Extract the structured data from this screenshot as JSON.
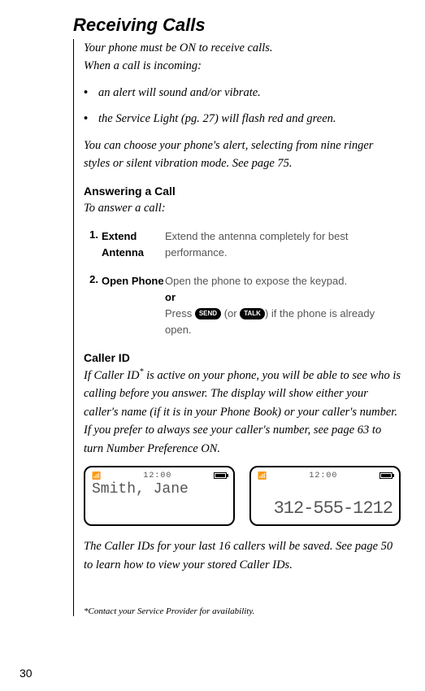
{
  "heading": "Receiving Calls",
  "intro1": "Your phone must be ON to receive calls.",
  "intro2": "When a call is incoming:",
  "bullets": [
    "an alert will sound and/or vibrate.",
    "the Service Light (pg. 27) will flash red and green."
  ],
  "intro3": "You can choose your phone's alert, selecting from nine ringer styles or silent vibration mode. See page 75.",
  "answering": {
    "title": "Answering a Call",
    "lead": "To answer a call:",
    "steps": [
      {
        "num": "1.",
        "label": "Extend Antenna",
        "desc": "Extend the antenna completely for best performance."
      },
      {
        "num": "2.",
        "label": "Open Phone",
        "desc1": "Open the phone to expose the keypad.",
        "or": "or",
        "desc2_a": "Press ",
        "key1": "SEND",
        "desc2_b": " (or ",
        "key2": "TALK",
        "desc2_c": ") if the phone is already open."
      }
    ]
  },
  "callerid": {
    "title": "Caller ID",
    "body": "If Caller ID* is active on your phone, you will be able to see who is calling before you answer. The display will show either your caller's name (if it is in your Phone Book) or your caller's number. If you prefer to always see your caller's number, see page 63 to turn Number Preference ON.",
    "displays": {
      "time": "12:00",
      "name": "Smith, Jane",
      "number": "312-555-1212"
    },
    "tail": "The Caller IDs for your last 16 callers will be saved. See page 50 to learn how to view your stored Caller IDs."
  },
  "footnote": "*Contact your Service Provider for availability.",
  "page": "30"
}
